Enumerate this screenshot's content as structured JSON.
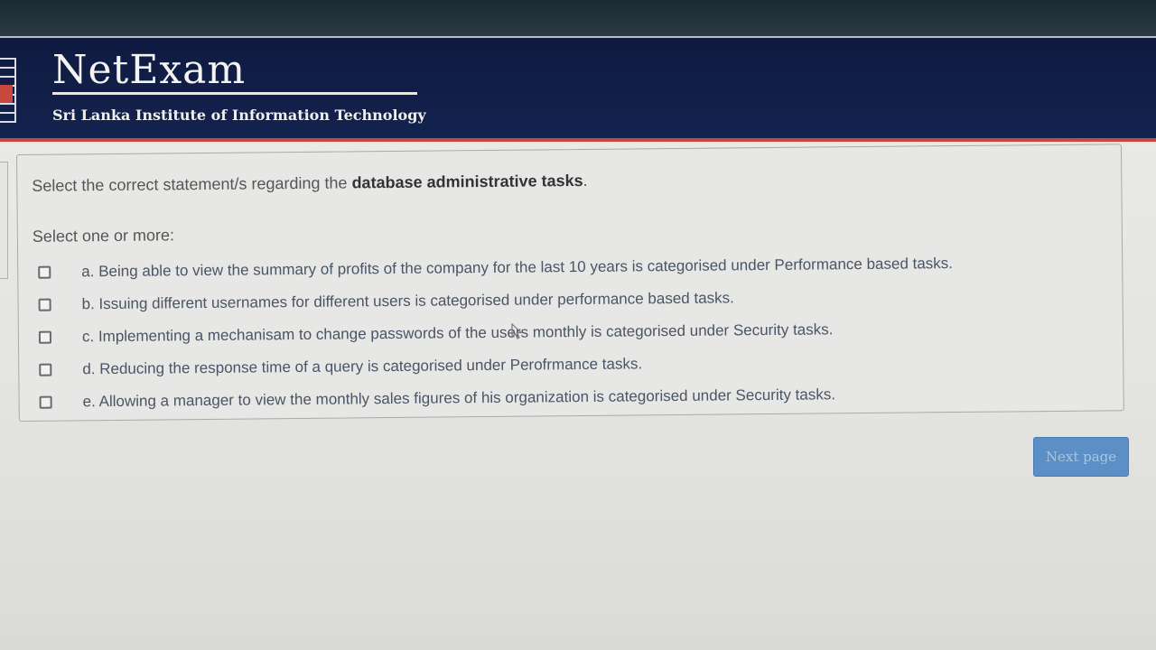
{
  "header": {
    "title": "NetExam",
    "subtitle": "Sri Lanka Institute of Information Technology"
  },
  "question": {
    "prefix": "Select the correct statement/s regarding the ",
    "emphasis": "database administrative tasks",
    "suffix": ".",
    "instruction": "Select one or more:",
    "options": [
      {
        "label": "a. Being able to view the summary of profits of the company for the last 10 years is categorised under Performance based tasks.",
        "checked": false
      },
      {
        "label": "b. Issuing different usernames for different users is categorised under performance based tasks.",
        "checked": false
      },
      {
        "label": "c. Implementing a mechanisam to change passwords of the users monthly is categorised under Security tasks.",
        "checked": false
      },
      {
        "label": "d. Reducing the response time of a query is categorised under Perofrmance tasks.",
        "checked": false
      },
      {
        "label": "e. Allowing a manager to view the monthly sales figures of his organization is categorised under Security tasks.",
        "checked": false
      }
    ]
  },
  "navigation": {
    "next_label": "Next page"
  },
  "colors": {
    "header_bg": "#14234f",
    "accent_red": "#c8473e",
    "button_bg": "#5b8fc6"
  }
}
